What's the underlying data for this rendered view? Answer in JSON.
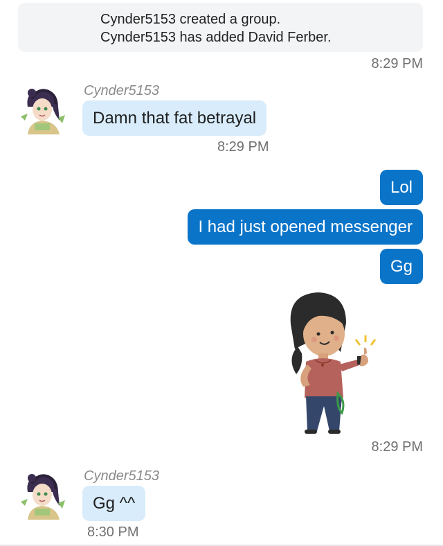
{
  "system": {
    "line1": "Cynder5153 created a group.",
    "line2": "Cynder5153 has added David Ferber.",
    "time": "8:29 PM"
  },
  "messages": {
    "in1": {
      "sender": "Cynder5153",
      "text": "Damn that fat betrayal",
      "time": "8:29 PM"
    },
    "out1": {
      "text": "Lol"
    },
    "out2": {
      "text": "I had just opened messenger"
    },
    "out3": {
      "text": "Gg"
    },
    "sticker": {
      "icon": "thumbs-up-girl-sticker",
      "time": "8:29 PM"
    },
    "in2": {
      "sender": "Cynder5153",
      "text": "Gg ^^",
      "time": "8:30 PM"
    }
  },
  "colors": {
    "outgoing_bubble": "#0a74c9",
    "incoming_bubble": "#d8ecfb",
    "system_box": "#f3f4f6"
  }
}
